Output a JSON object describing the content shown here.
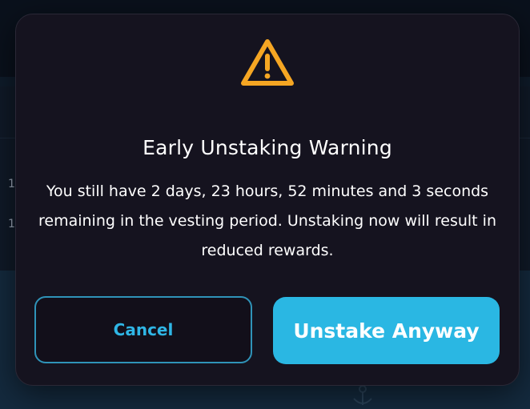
{
  "modal": {
    "title": "Early Unstaking Warning",
    "message": "You still have 2 days, 23 hours, 52 minutes and 3 seconds remaining in the vesting period. Unstaking now will result in reduced rewards.",
    "icon": "warning-triangle-icon",
    "cancel_label": "Cancel",
    "confirm_label": "Unstake Anyway"
  },
  "background": {
    "row_fragments": [
      "1",
      "1"
    ]
  },
  "colors": {
    "modal_bg": "#15131f",
    "warning_icon": "#f5a623",
    "accent": "#2ab7e3",
    "cancel_border": "#2f93b8",
    "cancel_text": "#2fb6e6"
  }
}
